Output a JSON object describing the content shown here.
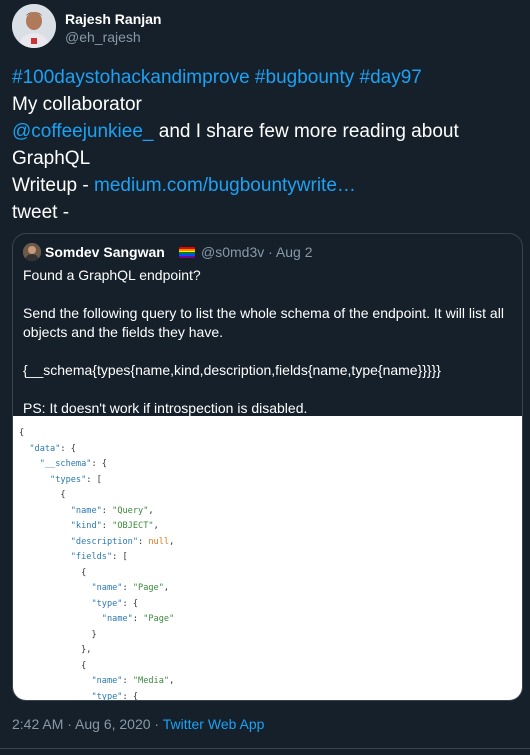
{
  "author": {
    "name": "Rajesh Ranjan",
    "handle": "@eh_rajesh"
  },
  "tweet": {
    "hashtags": "#100daystohackandimprove #bugbounty #day97",
    "line2": "My collaborator",
    "mention": "@coffeejunkiee_",
    "line3_rest": " and I share few more reading about",
    "line4": "GraphQL",
    "writeup_label": "Writeup - ",
    "writeup_link": "medium.com/bugbountywrite…",
    "tweet_label": "tweet -"
  },
  "quote": {
    "name": "Somdev Sangwan",
    "handle": "@s0md3v · Aug 2",
    "line1": "Found a GraphQL endpoint?",
    "line2": "Send the following query to list the whole schema of the endpoint. It will list all objects and the fields they have.",
    "line3": "{__schema{types{name,kind,description,fields{name,type{name}}}}}",
    "line4": "PS: It doesn't work if introspection is disabled."
  },
  "code_image": {
    "data_key": "\"data\"",
    "schema_key": "\"__schema\"",
    "types_key": "\"types\"",
    "name_key": "\"name\"",
    "kind_key": "\"kind\"",
    "description_key": "\"description\"",
    "fields_key": "\"fields\"",
    "type_key": "\"type\"",
    "query_val": "\"Query\"",
    "object_val": "\"OBJECT\"",
    "null_val": "null",
    "page_val": "\"Page\"",
    "media_val": "\"Media\""
  },
  "footer": {
    "time": "2:42 AM · Aug 6, 2020 · ",
    "app": "Twitter Web App"
  },
  "colors": {
    "background": "#15202b",
    "link": "#1da1f2",
    "muted": "#8899a6",
    "border": "#38444d"
  }
}
